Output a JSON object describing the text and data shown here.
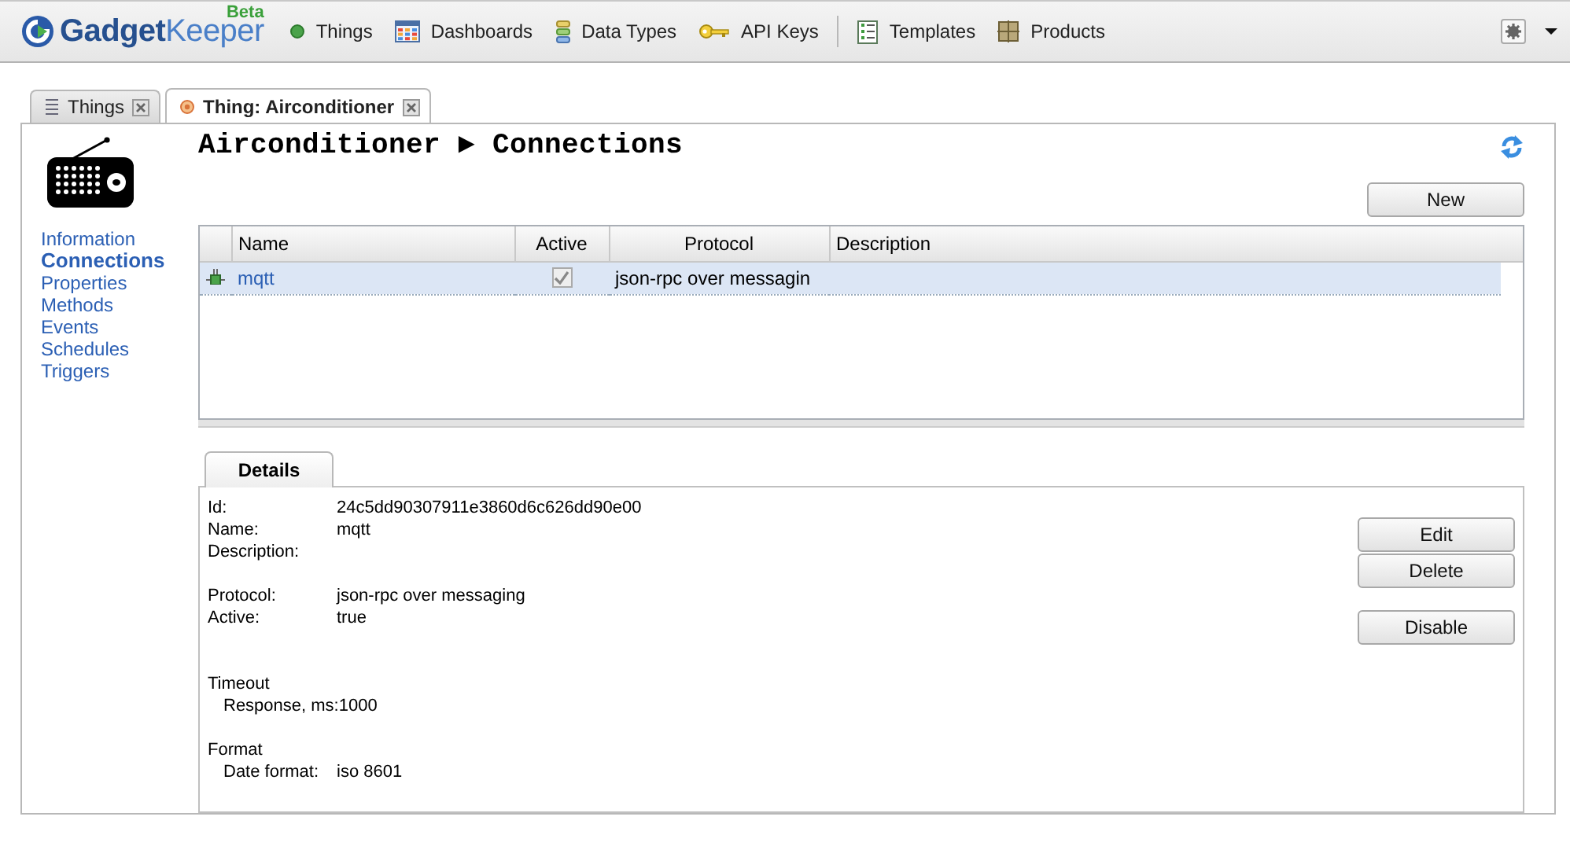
{
  "app": {
    "logo": "**Gadget**Keeper",
    "badge": "Beta"
  },
  "nav_groups": [
    {
      "items": [
        {
          "label": "Things"
        },
        {
          "label": "Dashboards"
        },
        {
          "label": "Data Types"
        },
        {
          "label": "API Keys"
        }
      ]
    },
    {
      "items": [
        {
          "label": "Templates"
        },
        {
          "label": "Products"
        }
      ]
    }
  ],
  "tabs": [
    {
      "label": "Things",
      "selected": false
    },
    {
      "label": "Thing: Airconditioner",
      "selected": true
    }
  ],
  "breadcrumb": {
    "thing": "Airconditioner",
    "separator": "►",
    "section": "Connections"
  },
  "sidebar": {
    "items": [
      {
        "label": "Information",
        "selected": false
      },
      {
        "label": "Connections",
        "selected": true
      },
      {
        "label": "Properties",
        "selected": false
      },
      {
        "label": "Methods",
        "selected": false
      },
      {
        "label": "Events",
        "selected": false
      },
      {
        "label": "Schedules",
        "selected": false
      },
      {
        "label": "Triggers",
        "selected": false
      }
    ]
  },
  "new_button": "New",
  "table": {
    "columns": [
      "Name",
      "Active",
      "Protocol",
      "Description"
    ],
    "rows": [
      {
        "name": "mqtt",
        "active": true,
        "protocol": "json-rpc over messagin",
        "selected": true
      }
    ]
  },
  "details": {
    "tab": "Details",
    "sections": [
      {
        "fields": [
          {
            "label": "Id:",
            "value": "24c5dd90307911e3860d6c626dd90e00"
          },
          {
            "label": "Name:",
            "value": "mqtt"
          },
          {
            "label": "Description:"
          }
        ]
      },
      {
        "fields": [
          {
            "label": "Protocol:",
            "value": "json-rpc over messaging"
          },
          {
            "label": "Active:",
            "value": "true"
          }
        ]
      },
      {
        "title": "Timeout",
        "fields": [
          {
            "label": "Response, ms:",
            "value": "1000"
          }
        ]
      },
      {
        "title": "Format",
        "fields": [
          {
            "label": "Date format:",
            "value": "iso 8601"
          }
        ]
      }
    ],
    "action_groups": [
      {
        "actions": [
          "Edit",
          "Delete"
        ]
      },
      {
        "actions": [
          "Disable"
        ]
      }
    ]
  }
}
